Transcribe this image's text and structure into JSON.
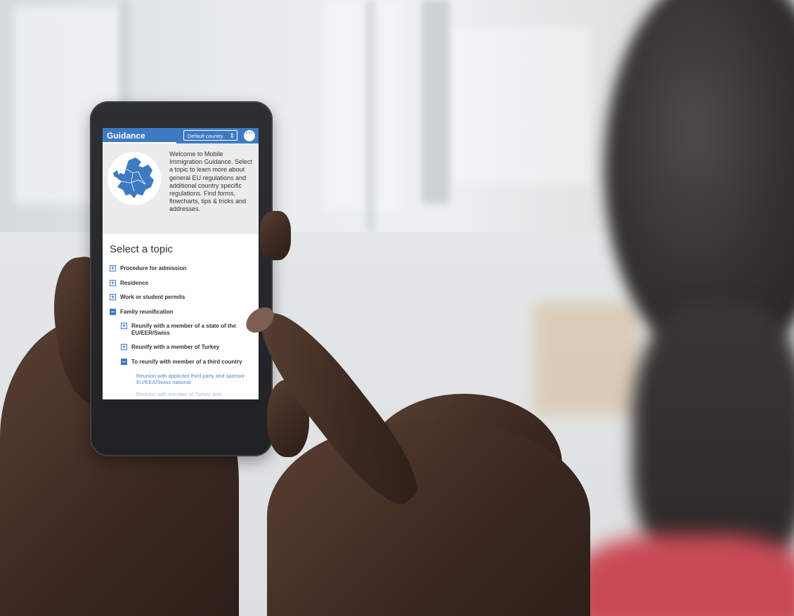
{
  "app": {
    "title": "Guidance",
    "country_select": "Default country"
  },
  "welcome": {
    "text": "Welcome to Mobile Immigration Guidance. Select a topic to learn more about general EU regulations and additional country specific regulations. Find forms, flowcharts, tips & tricks and addresses."
  },
  "topics": {
    "heading": "Select a topic",
    "items": [
      {
        "label": "Procedure for admission",
        "state": "collapsed"
      },
      {
        "label": "Residence",
        "state": "collapsed"
      },
      {
        "label": "Work or student permits",
        "state": "collapsed"
      },
      {
        "label": "Family reunification",
        "state": "expanded"
      }
    ],
    "subitems": [
      {
        "label": "Reunify with a member of a state of the EU/EER/Swiss",
        "state": "collapsed"
      },
      {
        "label": "Reunify with a member of Turkey",
        "state": "collapsed"
      },
      {
        "label": "To reunify with member of a third country",
        "state": "expanded"
      }
    ],
    "links": [
      "Reunion with applicant third party and sponsor EU/EEA/Swiss national",
      "Reunion with member of Turkey and"
    ]
  },
  "colors": {
    "accent": "#3e7ac2",
    "link": "#4f86c9"
  },
  "icons": {
    "expand": "plus-box-icon",
    "collapse": "minus-box-icon",
    "more": "ellipsis-circle-icon",
    "map": "europe-map-icon"
  }
}
